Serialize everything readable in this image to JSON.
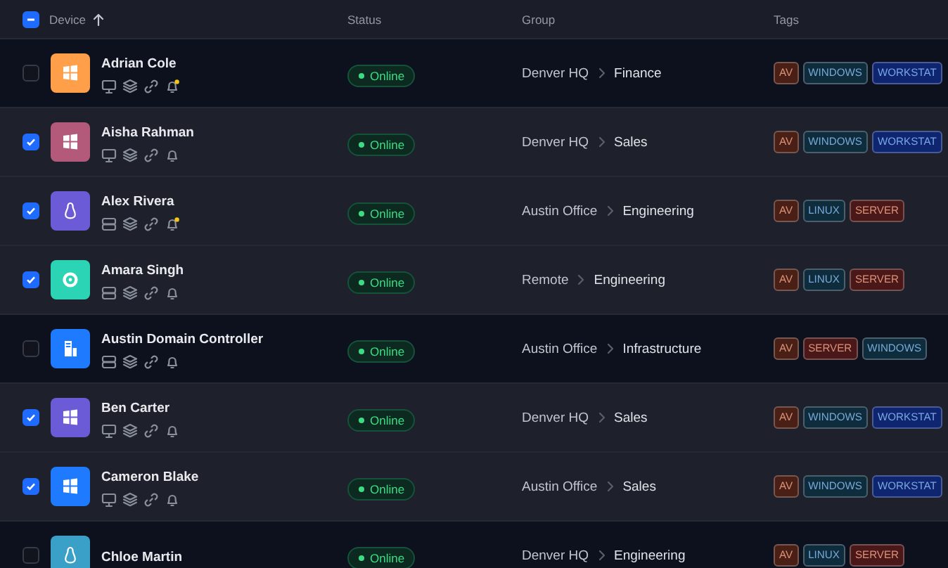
{
  "table": {
    "select_all": {
      "indeterminate": true
    },
    "columns": [
      {
        "label": "Device",
        "sorted": true
      },
      {
        "label": "Status",
        "sorted": false
      },
      {
        "label": "Group",
        "sorted": false
      },
      {
        "label": "Tags",
        "sorted": false
      }
    ],
    "rows": [
      {
        "name": "Adrian Cole",
        "selected": false,
        "kind": "windows",
        "color": "#ff9f4a",
        "server": false,
        "alert": true,
        "status": "Online",
        "online": true,
        "group": [
          "Denver HQ",
          "Finance"
        ],
        "tags": [
          {
            "label": "AV",
            "color": "#4a2016"
          },
          {
            "label": "WINDOWS",
            "color": "#0e2c3c"
          },
          {
            "label": "WORKSTAT",
            "color": "#0f2570"
          }
        ]
      },
      {
        "name": "Aisha Rahman",
        "selected": true,
        "kind": "windows",
        "color": "#b35a7a",
        "server": false,
        "alert": false,
        "status": "Online",
        "online": true,
        "group": [
          "Denver HQ",
          "Sales"
        ],
        "tags": [
          {
            "label": "AV",
            "color": "#4a2016"
          },
          {
            "label": "WINDOWS",
            "color": "#0e2c3c"
          },
          {
            "label": "WORKSTAT",
            "color": "#0f2570"
          }
        ]
      },
      {
        "name": "Alex Rivera",
        "selected": true,
        "kind": "linux",
        "color": "#6b5bd6",
        "server": true,
        "alert": true,
        "status": "Online",
        "online": true,
        "group": [
          "Austin Office",
          "Engineering"
        ],
        "tags": [
          {
            "label": "AV",
            "color": "#4a2016"
          },
          {
            "label": "LINUX",
            "color": "#0e2c3c"
          },
          {
            "label": "SERVER",
            "color": "#4a1818"
          }
        ]
      },
      {
        "name": "Amara Singh",
        "selected": true,
        "kind": "ubuntu",
        "color": "#2ad4b4",
        "server": true,
        "alert": false,
        "status": "Online",
        "online": true,
        "group": [
          "Remote",
          "Engineering"
        ],
        "tags": [
          {
            "label": "AV",
            "color": "#4a2016"
          },
          {
            "label": "LINUX",
            "color": "#0e2c3c"
          },
          {
            "label": "SERVER",
            "color": "#4a1818"
          }
        ]
      },
      {
        "name": "Austin Domain Controller",
        "selected": false,
        "kind": "building",
        "color": "#1e7bff",
        "server": true,
        "alert": false,
        "status": "Online",
        "online": true,
        "group": [
          "Austin Office",
          "Infrastructure"
        ],
        "tags": [
          {
            "label": "AV",
            "color": "#4a2016"
          },
          {
            "label": "SERVER",
            "color": "#4a1818"
          },
          {
            "label": "WINDOWS",
            "color": "#0e2c3c"
          }
        ]
      },
      {
        "name": "Ben Carter",
        "selected": true,
        "kind": "windows",
        "color": "#6b5bd6",
        "server": false,
        "alert": false,
        "status": "Online",
        "online": true,
        "group": [
          "Denver HQ",
          "Sales"
        ],
        "tags": [
          {
            "label": "AV",
            "color": "#4a2016"
          },
          {
            "label": "WINDOWS",
            "color": "#0e2c3c"
          },
          {
            "label": "WORKSTAT",
            "color": "#0f2570"
          }
        ]
      },
      {
        "name": "Cameron Blake",
        "selected": true,
        "kind": "windows",
        "color": "#1e7bff",
        "server": false,
        "alert": false,
        "status": "Online",
        "online": true,
        "group": [
          "Austin Office",
          "Sales"
        ],
        "tags": [
          {
            "label": "AV",
            "color": "#4a2016"
          },
          {
            "label": "WINDOWS",
            "color": "#0e2c3c"
          },
          {
            "label": "WORKSTAT",
            "color": "#0f2570"
          }
        ]
      },
      {
        "name": "Chloe Martin",
        "selected": false,
        "kind": "linux",
        "color": "#3aa0c8",
        "status": "Online",
        "online": true,
        "group": [
          "Denver HQ",
          "Engineering"
        ],
        "tags": [
          {
            "label": "AV",
            "color": "#4a2016"
          },
          {
            "label": "LINUX",
            "color": "#0e2c3c"
          },
          {
            "label": "SERVER",
            "color": "#4a1818"
          }
        ]
      }
    ]
  }
}
